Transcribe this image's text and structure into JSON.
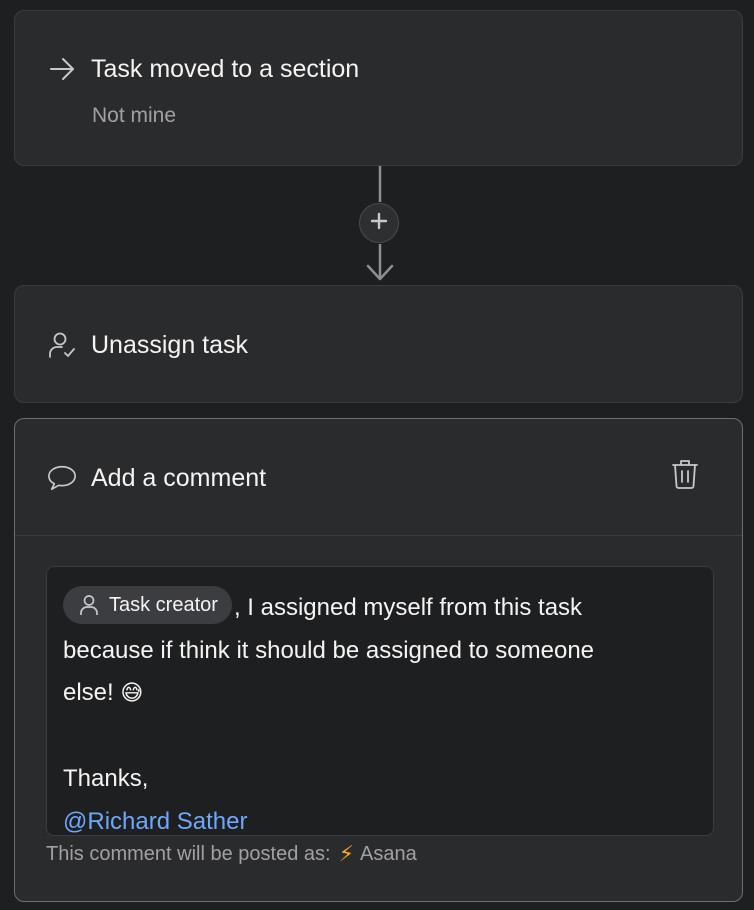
{
  "trigger": {
    "title": "Task moved to a section",
    "subtitle": "Not mine",
    "icon": "arrow-right-icon"
  },
  "connector": {
    "icon": "plus-icon"
  },
  "action_unassign": {
    "title": "Unassign task",
    "icon": "user-check-icon"
  },
  "action_comment": {
    "title": "Add a comment",
    "icon": "comment-bubble-icon",
    "delete_icon": "trash-icon",
    "editor": {
      "chip_label": "Task creator",
      "text_line1": ", I assigned myself from this task",
      "text_line2": "because if think it should be assigned to someone",
      "text_line3": "else!",
      "emoji": "😅",
      "thanks": "Thanks,",
      "mention": "@Richard Sather"
    },
    "posted_as_label": "This comment will be posted as:",
    "posted_as_name": "Asana"
  },
  "colors": {
    "background": "#1e1f21",
    "card": "#2a2b2d",
    "border": "#3b3c3f",
    "mention": "#6ea8fe",
    "bolt": "#f5a623"
  }
}
